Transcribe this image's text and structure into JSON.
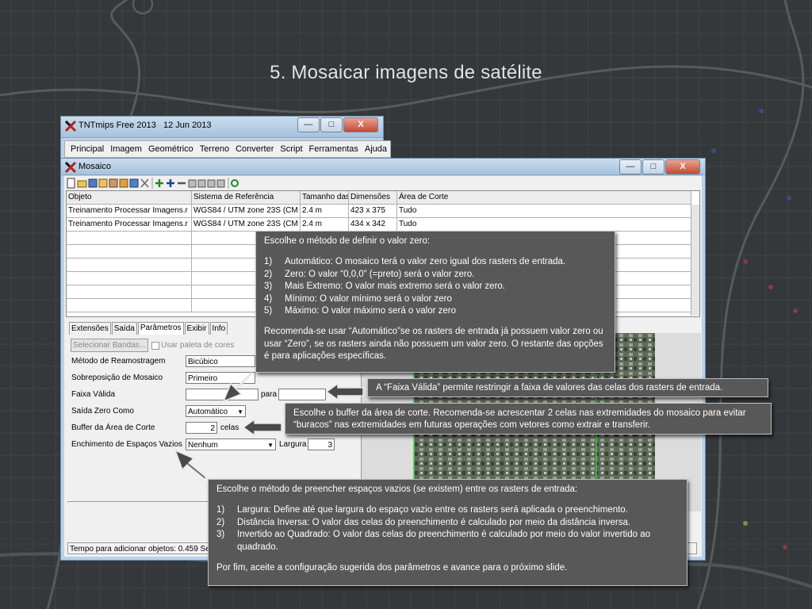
{
  "slide": {
    "title": "5. Mosaicar imagens de satélite"
  },
  "tntmips": {
    "title": "TNTmips Free 2013",
    "date": "12 Jun 2013",
    "controls": {
      "minimize": "—",
      "maximize": "□",
      "close": "X"
    },
    "menu": [
      "Principal",
      "Imagem",
      "Geométrico",
      "Terreno",
      "Converter",
      "Script",
      "Ferramentas",
      "Ajuda"
    ]
  },
  "mosaico": {
    "title": "Mosaico",
    "controls": {
      "minimize": "—",
      "maximize": "□",
      "close": "X"
    },
    "table": {
      "headers": [
        "Objeto",
        "Sistema de Referência",
        "Tamanho das",
        "Dimensões",
        "Área de Corte"
      ],
      "rows": [
        [
          "Treinamento Processar Imagens.r",
          "WGS84 / UTM zone 23S (CM -",
          "2.4 m",
          "423 x 375",
          "Tudo"
        ],
        [
          "Treinamento Processar Imagens.r",
          "WGS84 / UTM zone 23S (CM -",
          "2.4 m",
          "434 x 342",
          "Tudo"
        ]
      ]
    },
    "tabs": [
      "Extensões",
      "Saída",
      "Parâmetros",
      "Exibir",
      "Info"
    ],
    "active_tab": "Parâmetros",
    "select_bands_button": "Selecionar Bandas...",
    "palette_checkbox": "Usar paleta de cores",
    "params": {
      "resample_label": "Método de Reamostragem",
      "resample_value": "Bicúbico",
      "overlap_label": "Sobreposição de Mosaico",
      "overlap_value": "Primeiro",
      "valid_range_label": "Faixa Válida",
      "valid_range_to": "para",
      "zero_out_label": "Saída Zero Como",
      "zero_out_value": "Automático",
      "buffer_label": "Buffer da Área de Corte",
      "buffer_value": "2",
      "buffer_unit": "celas",
      "fill_label": "Enchimento de Espaços Vazios",
      "fill_value": "Nenhum",
      "fill_width_label": "Largura",
      "fill_width_value": "3"
    },
    "status": "Tempo para adicionar objetos: 0.459 Se"
  },
  "callouts": {
    "zero": {
      "intro": "Escolhe o método de definir o valor zero:",
      "items": [
        {
          "num": "1)",
          "text": "Automático: O mosaico terá o valor zero igual dos rasters de entrada."
        },
        {
          "num": "2)",
          "text": "Zero: O valor “0,0,0” (=preto) será o valor zero."
        },
        {
          "num": "3)",
          "text": "Mais Extremo: O valor mais extremo será o valor zero."
        },
        {
          "num": "4)",
          "text": "Mínimo: O valor mínimo será o valor zero"
        },
        {
          "num": "5)",
          "text": "Máximo: O valor máximo será o valor zero"
        }
      ],
      "outro": "Recomenda-se usar “Automático”se os rasters de entrada já possuem valor zero ou usar “Zero”, se os rasters ainda não possuem um valor zero. O restante das opções é para aplicações específicas."
    },
    "valid_range": "A “Faixa Válida” permite restringir a faixa de valores das celas dos rasters de entrada.",
    "buffer": "Escolhe o buffer da área de corte. Recomenda-se acrescentar 2 celas nas extremidades do mosaico para evitar “buracos” nas extremidades em futuras operações com vetores como extrair e transferir.",
    "fill": {
      "intro": "Escolhe o método de preencher espaços vazios (se existem) entre os rasters de entrada:",
      "items": [
        {
          "num": "1)",
          "text": "Largura: Define até que largura do espaço vazio entre os rasters será aplicada o preenchimento."
        },
        {
          "num": "2)",
          "text": "Distância Inversa: O valor das celas do preenchimento é calculado por meio da distância inversa."
        },
        {
          "num": "3)",
          "text": "Invertido ao Quadrado: O valor das celas do preenchimento é calculado por meio do valor invertido ao quadrado."
        }
      ],
      "outro": "Por fim, aceite a configuração sugerida dos parâmetros e avance para o próximo slide."
    }
  },
  "colors": {
    "slide_bg": "#34383a",
    "callout_bg": "#585858",
    "arrow": "#4a4a4a"
  }
}
